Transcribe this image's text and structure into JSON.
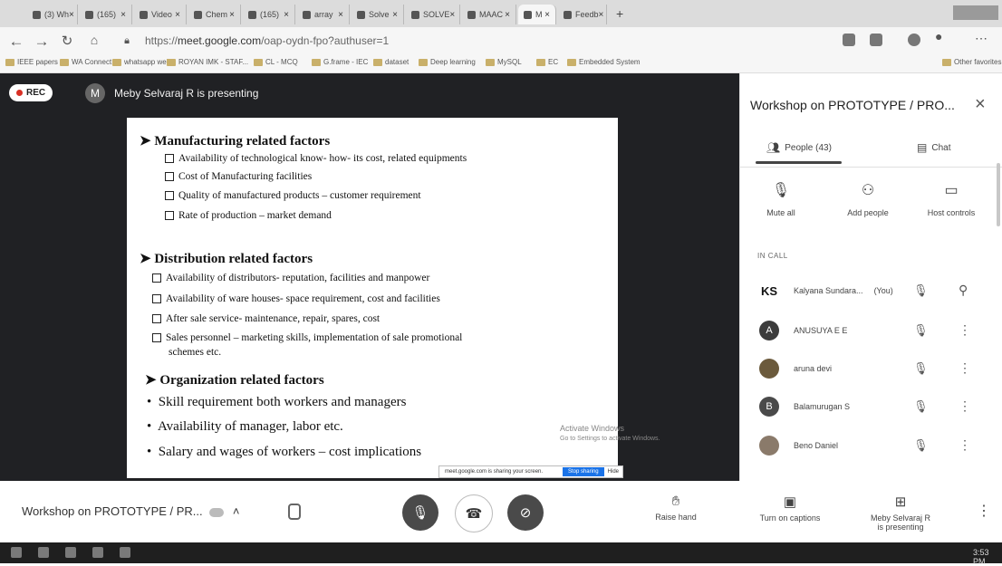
{
  "browser": {
    "tabs": [
      {
        "label": "(3) Wh"
      },
      {
        "label": "(165)"
      },
      {
        "label": "Video"
      },
      {
        "label": "Chem"
      },
      {
        "label": "(165)"
      },
      {
        "label": "array"
      },
      {
        "label": "Solve"
      },
      {
        "label": "SOLVE"
      },
      {
        "label": "MAAC"
      },
      {
        "label": "M"
      },
      {
        "label": "Feedb"
      }
    ],
    "new_tab": "+",
    "url_prefix": "https://",
    "url_host": "meet.google.com",
    "url_path": "/oap-oydn-fpo?authuser=1",
    "bookmarks": [
      "IEEE papers",
      "WA Connect",
      "whatsapp web",
      "ROYAN IMK - STAF...",
      "CL - MCQ",
      "G.frame - IEC",
      "dataset",
      "Deep learning",
      "MySQL",
      "EC",
      "Embedded System"
    ],
    "other_favorites": "Other favorites"
  },
  "meet": {
    "rec_label": "REC",
    "presenter_initial": "M",
    "presenting_text": "Meby Selvaraj R is presenting",
    "slide": {
      "h1": "Manufacturing related factors",
      "items1": [
        "Availability of technological know- how- its cost, related equipments",
        "Cost of Manufacturing facilities",
        "Quality of manufactured products – customer requirement",
        "Rate of production – market demand"
      ],
      "h2": "Distribution related factors",
      "items2": [
        "Availability of distributors- reputation, facilities and manpower",
        "Availability of ware houses- space requirement, cost and facilities",
        "After sale service- maintenance, repair, spares, cost",
        "Sales personnel – marketing skills, implementation of sale promotional"
      ],
      "items2_cont": "schemes etc.",
      "h3": "Organization related factors",
      "bullets": [
        "Skill requirement both workers and managers",
        "Availability of manager, labor etc.",
        "Salary and wages of workers – cost implications"
      ]
    },
    "activate_line1": "Activate Windows",
    "activate_line2": "Go to Settings to activate Windows.",
    "share_text": "meet.google.com is sharing your screen.",
    "share_stop": "Stop sharing",
    "share_hide": "Hide"
  },
  "panel": {
    "title": "Workshop on PROTOTYPE / PRO...",
    "tab_people": "People (43)",
    "tab_chat": "Chat",
    "actions": [
      "Mute all",
      "Add people",
      "Host controls"
    ],
    "in_call": "IN CALL",
    "participants": [
      {
        "initial": "KS",
        "name": "Kalyana Sundara...",
        "suffix": "(You)",
        "color": "#222222"
      },
      {
        "initial": "A",
        "name": "ANUSUYA E E",
        "suffix": "",
        "color": "#3c3c3c"
      },
      {
        "initial": "",
        "name": "aruna devi",
        "suffix": "",
        "color": "#6b5a3c"
      },
      {
        "initial": "B",
        "name": "Balamurugan S",
        "suffix": "",
        "color": "#4a4a4a"
      },
      {
        "initial": "",
        "name": "Beno Daniel",
        "suffix": "",
        "color": "#8a7a6a"
      }
    ]
  },
  "bottom": {
    "meeting_title": "Workshop on PROTOTYPE / PR...",
    "raise_hand": "Raise hand",
    "captions": "Turn on captions",
    "presenting_line1": "Meby Selvaraj R",
    "presenting_line2": "is presenting"
  },
  "taskbar": {
    "time": "3:53 PM"
  }
}
